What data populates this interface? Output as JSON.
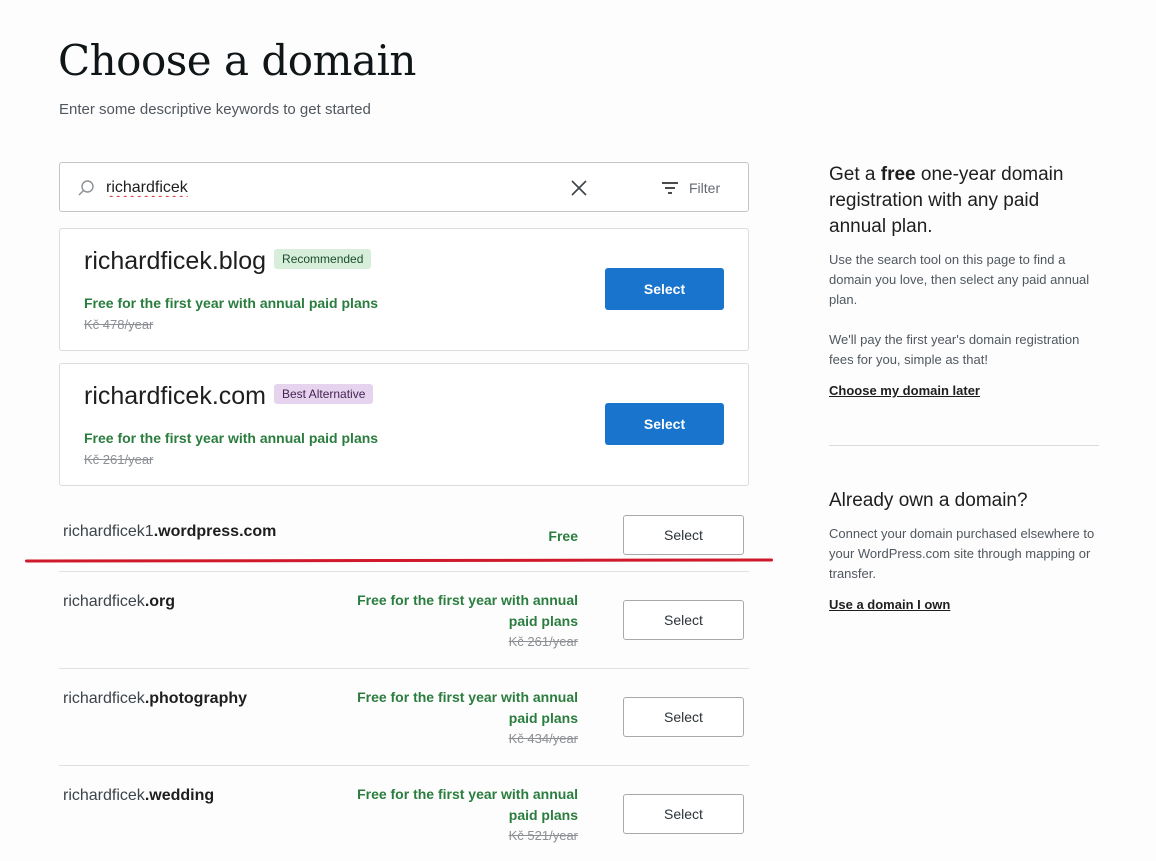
{
  "header": {
    "title": "Choose a domain",
    "subtitle": "Enter some descriptive keywords to get started"
  },
  "search": {
    "value": "richardficek",
    "filter_label": "Filter"
  },
  "featured": [
    {
      "name": "richardficek.blog",
      "badge": "Recommended",
      "promo": "Free for the first year with annual paid plans",
      "price": "Kč 478/year",
      "select_label": "Select"
    },
    {
      "name": "richardficek.com",
      "badge": "Best Alternative",
      "promo": "Free for the first year with annual paid plans",
      "price": "Kč 261/year",
      "select_label": "Select"
    }
  ],
  "results": [
    {
      "base": "richardficek1",
      "tld": ".wordpress.com",
      "promo": "Free",
      "price": "",
      "select_label": "Select"
    },
    {
      "base": "richardficek",
      "tld": ".org",
      "promo": "Free for the first year with annual paid plans",
      "price": "Kč 261/year",
      "select_label": "Select"
    },
    {
      "base": "richardficek",
      "tld": ".photography",
      "promo": "Free for the first year with annual paid plans",
      "price": "Kč 434/year",
      "select_label": "Select"
    },
    {
      "base": "richardficek",
      "tld": ".wedding",
      "promo": "Free for the first year with annual paid plans",
      "price": "Kč 521/year",
      "select_label": "Select"
    }
  ],
  "sidebar": {
    "free_heading_pre": "Get a ",
    "free_heading_bold": "free",
    "free_heading_post": " one-year domain registration with any paid annual plan.",
    "free_p1": "Use the search tool on this page to find a domain you love, then select any paid annual plan.",
    "free_p2": "We'll pay the first year's domain registration fees for you, simple as that!",
    "free_link": "Choose my domain later",
    "own_heading": "Already own a domain?",
    "own_p": "Connect your domain purchased elsewhere to your WordPress.com site through mapping or transfer.",
    "own_link": "Use a domain I own"
  },
  "colors": {
    "primary": "#1874cd",
    "promo_green": "#2a7d3e",
    "annotation_red": "#d0192a"
  }
}
